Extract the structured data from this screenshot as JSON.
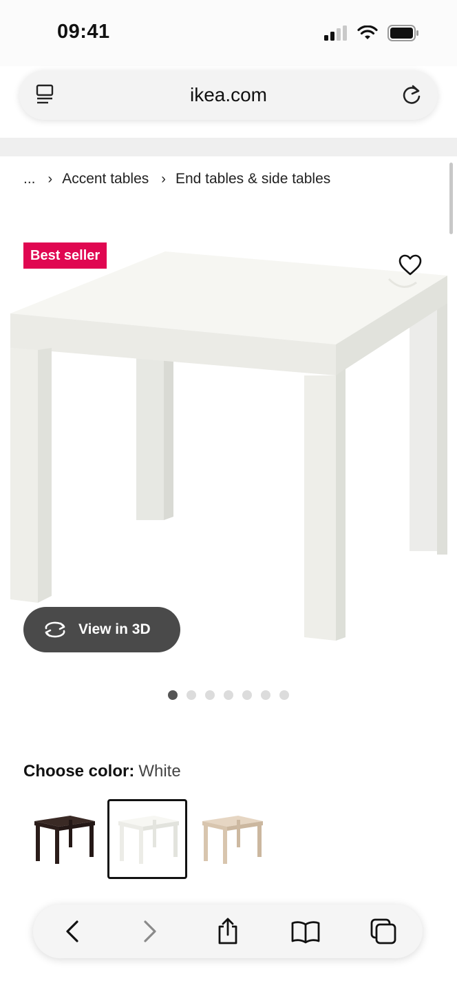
{
  "status_bar": {
    "time": "09:41"
  },
  "browser": {
    "url": "ikea.com"
  },
  "breadcrumb": {
    "ellipsis": "...",
    "items": [
      "Accent tables",
      "End tables & side tables"
    ]
  },
  "product": {
    "badge": "Best seller",
    "view_3d_label": "View in 3D",
    "image_count": 7,
    "active_image_index": 0
  },
  "color_picker": {
    "label": "Choose color:",
    "selected_value": "White",
    "swatches": [
      {
        "name": "black-brown",
        "color": "#2b1d1a"
      },
      {
        "name": "white",
        "color": "#f4f4ef"
      },
      {
        "name": "white-stained-oak",
        "color": "#dcc9b3"
      }
    ]
  },
  "colors": {
    "badge": "#e00751",
    "view_3d_bg": "#4a4a4a"
  },
  "icons": {
    "url_left": "reader-icon",
    "url_right": "reload-icon",
    "toolbar": [
      "back-icon",
      "forward-icon",
      "share-icon",
      "bookmarks-icon",
      "tabs-icon"
    ]
  }
}
